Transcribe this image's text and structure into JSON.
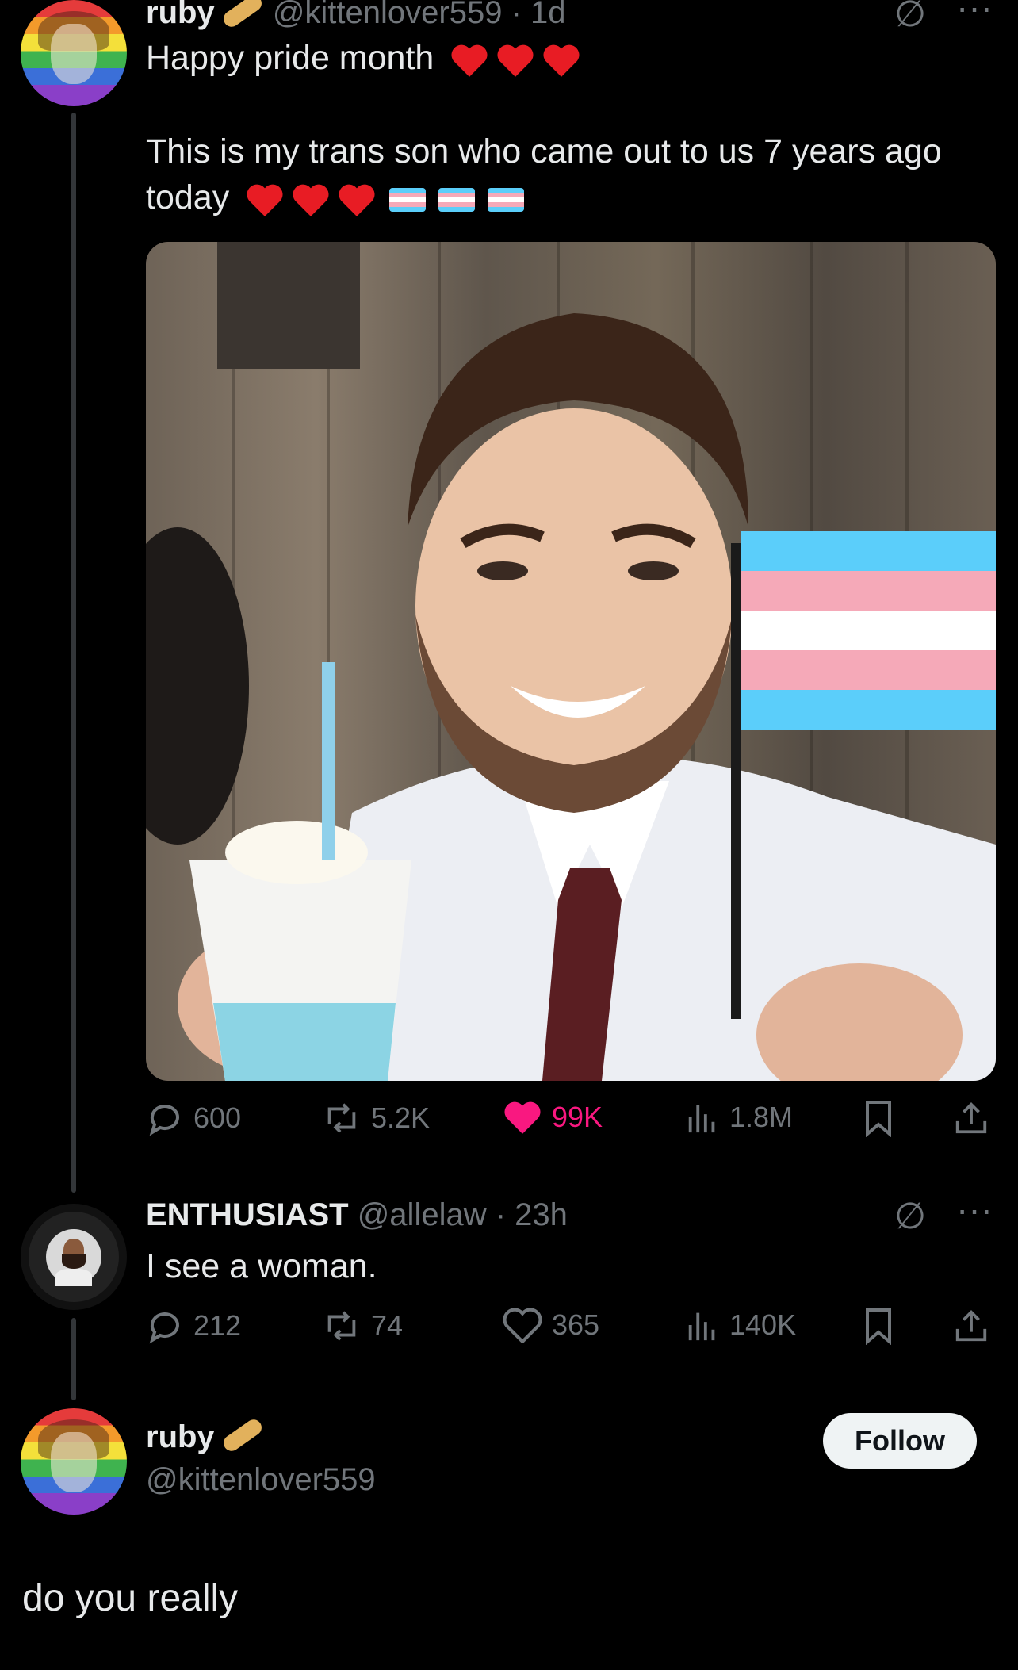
{
  "tweet": {
    "author_name": "ruby",
    "author_handle": "@kittenlover559",
    "timestamp": "· 1d",
    "text_line1": "Happy pride month",
    "text_line2": "This is my trans son who came out to us 7 years ago",
    "text_line3": "today",
    "stats": {
      "replies": "600",
      "retweets": "5.2K",
      "likes": "99K",
      "views": "1.8M"
    }
  },
  "reply": {
    "author_name": "ENTHUSIAST",
    "author_handle": "@allelaw",
    "timestamp": "· 23h",
    "text": "I see a woman.",
    "stats": {
      "replies": "212",
      "retweets": "74",
      "likes": "365",
      "views": "140K"
    }
  },
  "response": {
    "author_name": "ruby",
    "author_handle": "@kittenlover559",
    "follow_label": "Follow",
    "text": "do you really"
  },
  "colors": {
    "background": "#000000",
    "text": "#e7e9ea",
    "muted": "#71767b",
    "like": "#f91880"
  }
}
